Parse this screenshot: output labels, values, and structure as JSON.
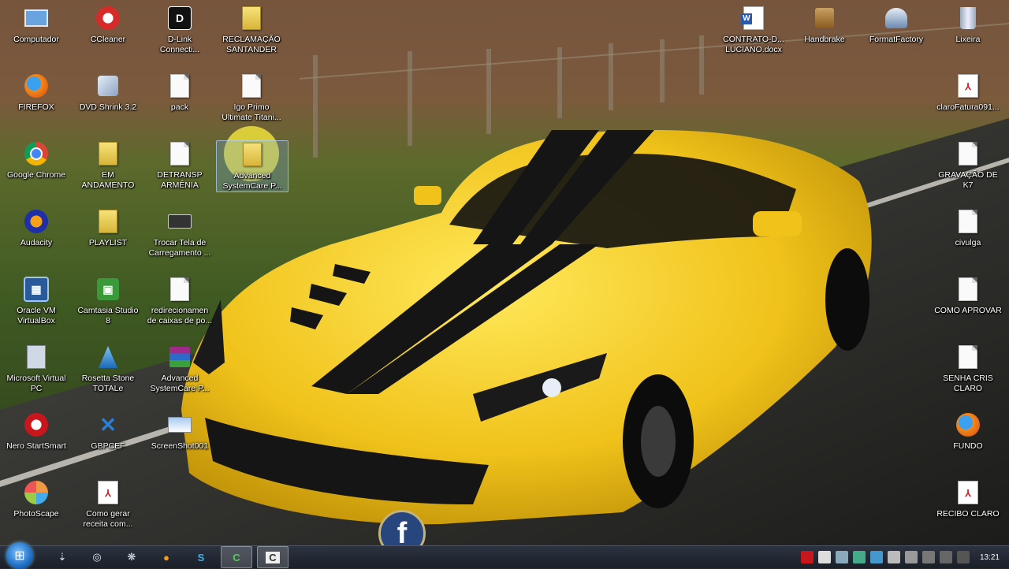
{
  "desktop": {
    "icons": [
      {
        "key": "computador",
        "label": "Computador",
        "icon": "computer-icon"
      },
      {
        "key": "ccleaner",
        "label": "CCleaner",
        "icon": "ccleaner-icon"
      },
      {
        "key": "dlink",
        "label": "D-Link\nConnecti...",
        "icon": "dlink-icon"
      },
      {
        "key": "reclamacao",
        "label": "RECLAMAÇÃO\nSANTANDER",
        "icon": "folder-icon"
      },
      {
        "key": "firefox",
        "label": "FIREFOX",
        "icon": "firefox-icon"
      },
      {
        "key": "dvdshrink",
        "label": "DVD Shrink 3.2",
        "icon": "dvd-shrink-icon"
      },
      {
        "key": "pack",
        "label": "pack",
        "icon": "document-icon"
      },
      {
        "key": "igo",
        "label": "Igo Primo\nUltimate Titani...",
        "icon": "document-icon"
      },
      {
        "key": "chrome",
        "label": "Google Chrome",
        "icon": "chrome-icon"
      },
      {
        "key": "emandamento",
        "label": "EM\nANDAMENTO",
        "icon": "folder-icon"
      },
      {
        "key": "detransp",
        "label": "DETRANSP\nARMÊNIA",
        "icon": "document-icon"
      },
      {
        "key": "advanced1",
        "label": "Advanced\nSystemCare P...",
        "icon": "folder-icon"
      },
      {
        "key": "audacity",
        "label": "Audacity",
        "icon": "audacity-icon"
      },
      {
        "key": "playlist",
        "label": "PLAYLIST",
        "icon": "folder-icon"
      },
      {
        "key": "trocartela",
        "label": "Trocar Tela de\nCarregamento ...",
        "icon": "keyboard-icon"
      },
      {
        "key": "virtualbox",
        "label": "Oracle VM\nVirtualBox",
        "icon": "virtualbox-icon"
      },
      {
        "key": "camtasia",
        "label": "Camtasia Studio\n8",
        "icon": "camtasia-icon"
      },
      {
        "key": "redirecionamento",
        "label": "redirecionamen\nde caixas de po...",
        "icon": "document-icon"
      },
      {
        "key": "virtualpc",
        "label": "Microsoft Virtual\nPC",
        "icon": "virtual-pc-icon"
      },
      {
        "key": "rosetta",
        "label": "Rosetta Stone\nTOTALe",
        "icon": "rosetta-icon"
      },
      {
        "key": "advanced2",
        "label": "Advanced\nSystemCare P...",
        "icon": "winrar-icon"
      },
      {
        "key": "nero",
        "label": "Nero StartSmart",
        "icon": "nero-icon"
      },
      {
        "key": "gbpcef",
        "label": "GBPCEF",
        "icon": "gbpcef-icon"
      },
      {
        "key": "screenshot",
        "label": "ScreenShot001",
        "icon": "image-icon"
      },
      {
        "key": "photoscape",
        "label": "PhotoScape",
        "icon": "photoscape-icon"
      },
      {
        "key": "comogerar",
        "label": "Como gerar\nreceita com...",
        "icon": "pdf-icon"
      },
      {
        "key": "contrato",
        "label": "CONTRATO-D...\nLUCIANO.docx",
        "icon": "word-icon"
      },
      {
        "key": "handbrake",
        "label": "Handbrake",
        "icon": "handbrake-icon"
      },
      {
        "key": "formatfactory",
        "label": "FormatFactory",
        "icon": "formatfactory-icon"
      },
      {
        "key": "lixeira",
        "label": "Lixeira",
        "icon": "recycle-bin-icon"
      },
      {
        "key": "clarofatura",
        "label": "claroFatura091...",
        "icon": "pdf-icon"
      },
      {
        "key": "gravacao",
        "label": "GRAVAÇÃO DE\nK7",
        "icon": "document-icon"
      },
      {
        "key": "civulga",
        "label": "civulga",
        "icon": "document-icon"
      },
      {
        "key": "comoaprovar",
        "label": "COMO APROVAR",
        "icon": "document-icon"
      },
      {
        "key": "senha",
        "label": "SENHA CRIS\nCLARO",
        "icon": "document-icon"
      },
      {
        "key": "fundo",
        "label": "FUNDO",
        "icon": "firefox-icon"
      },
      {
        "key": "recibo",
        "label": "RECIBO CLARO",
        "icon": "pdf-icon"
      }
    ]
  },
  "overlay": {
    "facebook_glyph": "f"
  },
  "taskbar": {
    "start_glyph": "⊞",
    "clock": "13:21",
    "items": [
      {
        "key": "tb-1",
        "glyph": "⇣"
      },
      {
        "key": "tb-2",
        "glyph": "◎"
      },
      {
        "key": "tb-3",
        "glyph": "❋"
      },
      {
        "key": "tb-4",
        "glyph": "●"
      },
      {
        "key": "tb-5",
        "glyph": "S"
      },
      {
        "key": "tb-6",
        "glyph": "C"
      },
      {
        "key": "tb-7",
        "glyph": "C"
      }
    ]
  },
  "colors": {
    "taskbar": "#1f2530",
    "car": "#f2c81e",
    "stripe": "#151515"
  }
}
